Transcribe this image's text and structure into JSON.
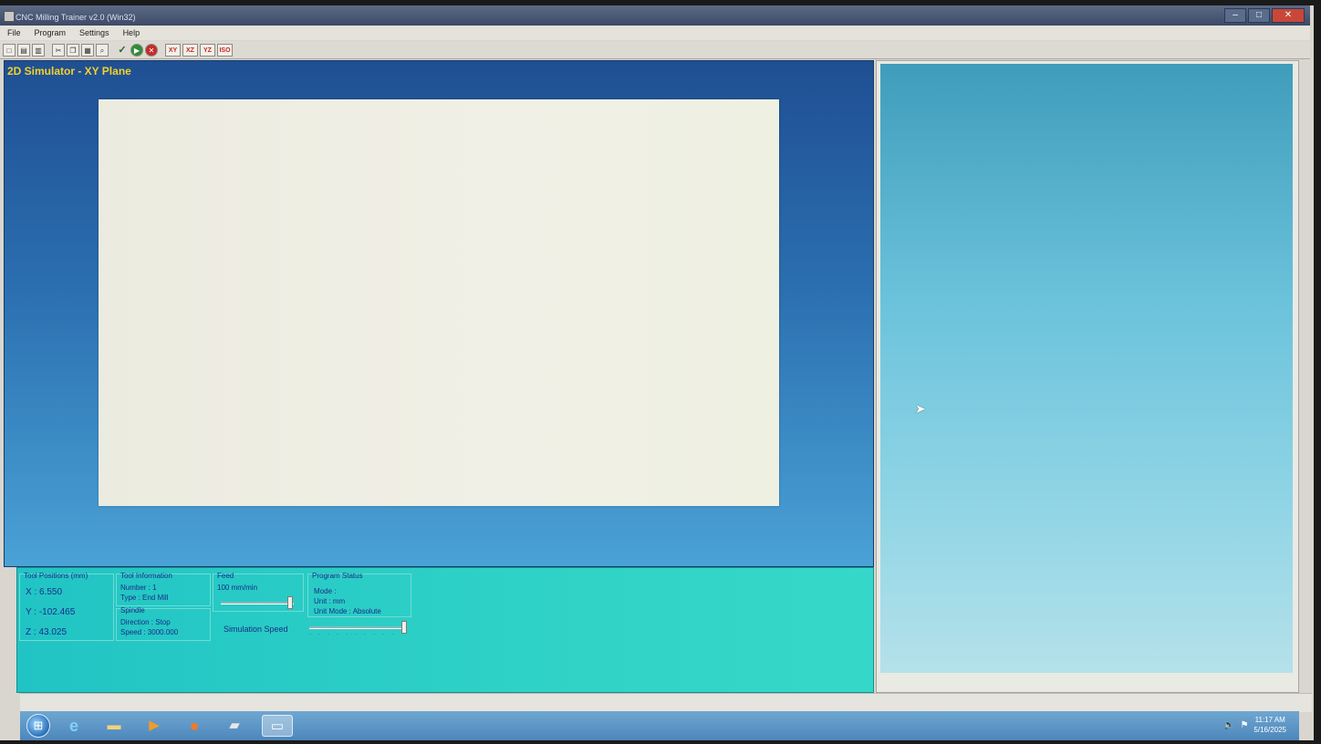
{
  "window": {
    "title": "CNC Milling Trainer v2.0 (Win32)",
    "controls": {
      "minimize": "–",
      "maximize": "□",
      "close": "✕"
    }
  },
  "menu": [
    "File",
    "Program",
    "Settings",
    "Help"
  ],
  "toolbar": {
    "buttons": [
      {
        "name": "new-icon",
        "glyph": "□"
      },
      {
        "name": "open-icon",
        "glyph": "▤"
      },
      {
        "name": "save-icon",
        "glyph": "▥"
      },
      {
        "name": "cut-icon",
        "glyph": "✂"
      },
      {
        "name": "copy-icon",
        "glyph": "❐"
      },
      {
        "name": "paste-icon",
        "glyph": "▦"
      },
      {
        "name": "find-icon",
        "glyph": "⌕"
      }
    ],
    "check_glyph": "✓",
    "run_glyph": "▶",
    "stop_glyph": "✕",
    "plane_buttons": [
      "XY",
      "XZ",
      "YZ",
      "ISO"
    ]
  },
  "simulator": {
    "title": "2D Simulator - XY Plane"
  },
  "status": {
    "tool_positions": {
      "title": "Tool Positions (mm)",
      "x": "X : 6.550",
      "y": "Y : -102.465",
      "z": "Z : 43.025"
    },
    "tool_information": {
      "title": "Tool Information",
      "number": "Number : 1",
      "type": "Type : End Mill"
    },
    "spindle": {
      "title": "Spindle",
      "direction": "Direction : Stop",
      "speed": "Speed : 3000.000"
    },
    "feed": {
      "title": "Feed",
      "value": "100 mm/min",
      "level": 0.95
    },
    "simulation_speed": {
      "label": "Simulation Speed",
      "level": 1.0
    },
    "program_status": {
      "title": "Program Status",
      "mode": "Mode :",
      "unit": "Unit : mm",
      "unit_mode": "Unit Mode : Absolute"
    }
  },
  "taskbar": {
    "start_glyph": "⊞",
    "apps": [
      {
        "name": "internet-explorer-icon",
        "glyph": "e"
      },
      {
        "name": "file-explorer-icon",
        "glyph": "▬"
      },
      {
        "name": "media-player-icon",
        "glyph": "▶"
      },
      {
        "name": "firefox-icon",
        "glyph": "●"
      },
      {
        "name": "app-icon",
        "glyph": "▰"
      },
      {
        "name": "cnc-window-icon",
        "glyph": "▭"
      }
    ],
    "time": "11:17 AM",
    "date": "5/16/2025"
  },
  "colors": {
    "simulator_title": "#f2d12a",
    "status_text": "#1a2d8a",
    "status_panel": "#2fd2c6"
  }
}
